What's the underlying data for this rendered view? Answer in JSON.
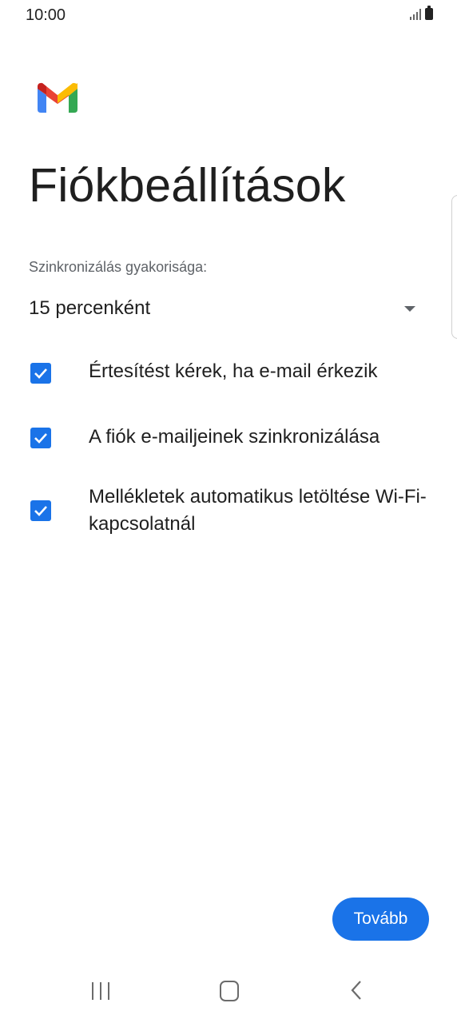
{
  "status_bar": {
    "time": "10:00"
  },
  "app": {
    "logo_icon": "gmail-logo-icon",
    "title": "Fiókbeállítások"
  },
  "sync_frequency": {
    "label": "Szinkronizálás gyakorisága:",
    "selected": "15 percenként",
    "icon": "dropdown-arrow-icon"
  },
  "options": [
    {
      "label": "Értesítést kérek, ha e-mail érkezik",
      "checked": true
    },
    {
      "label": "A fiók e-mailjeinek szinkronizálása",
      "checked": true
    },
    {
      "label": "Mellékletek automatikus letöltése Wi-Fi-kapcsolatnál",
      "checked": true
    }
  ],
  "next_button": {
    "label": "Tovább"
  },
  "colors": {
    "accent": "#1a73e8",
    "text_primary": "#1f1f1f",
    "text_secondary": "#5f6368"
  },
  "nav_bar": {
    "icons": [
      "recents-icon",
      "home-icon",
      "back-icon"
    ]
  }
}
